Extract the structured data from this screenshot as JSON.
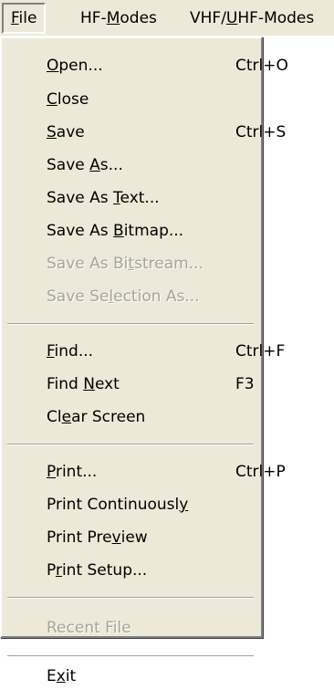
{
  "menubar": {
    "items": [
      {
        "pre": "",
        "ul": "F",
        "post": "ile"
      },
      {
        "pre": "HF-",
        "ul": "M",
        "post": "odes"
      },
      {
        "pre": "VHF/",
        "ul": "U",
        "post": "HF-Modes"
      }
    ]
  },
  "file_menu": {
    "items": [
      {
        "pre": "",
        "ul": "O",
        "post": "pen...",
        "shortcut": "Ctrl+O",
        "enabled": true
      },
      {
        "pre": "",
        "ul": "C",
        "post": "lose",
        "shortcut": "",
        "enabled": true
      },
      {
        "pre": "",
        "ul": "S",
        "post": "ave",
        "shortcut": "Ctrl+S",
        "enabled": true
      },
      {
        "pre": "Save ",
        "ul": "A",
        "post": "s...",
        "shortcut": "",
        "enabled": true
      },
      {
        "pre": "Save As ",
        "ul": "T",
        "post": "ext...",
        "shortcut": "",
        "enabled": true
      },
      {
        "pre": "Save As ",
        "ul": "B",
        "post": "itmap...",
        "shortcut": "",
        "enabled": true
      },
      {
        "pre": "Save As Bi",
        "ul": "t",
        "post": "stream...",
        "shortcut": "",
        "enabled": false
      },
      {
        "pre": "Save Se",
        "ul": "l",
        "post": "ection As...",
        "shortcut": "",
        "enabled": false
      },
      {
        "pre": "",
        "ul": "F",
        "post": "ind...",
        "shortcut": "Ctrl+F",
        "enabled": true
      },
      {
        "pre": "Find ",
        "ul": "N",
        "post": "ext",
        "shortcut": "F3",
        "enabled": true
      },
      {
        "pre": "Cl",
        "ul": "e",
        "post": "ar Screen",
        "shortcut": "",
        "enabled": true
      },
      {
        "pre": "",
        "ul": "P",
        "post": "rint...",
        "shortcut": "Ctrl+P",
        "enabled": true
      },
      {
        "pre": "Print Continuousl",
        "ul": "y",
        "post": "",
        "shortcut": "",
        "enabled": true
      },
      {
        "pre": "Print Pre",
        "ul": "v",
        "post": "iew",
        "shortcut": "",
        "enabled": true
      },
      {
        "pre": "P",
        "ul": "r",
        "post": "int Setup...",
        "shortcut": "",
        "enabled": true
      },
      {
        "pre": "Recent File",
        "ul": "",
        "post": "",
        "shortcut": "",
        "enabled": false
      },
      {
        "pre": "E",
        "ul": "x",
        "post": "it",
        "shortcut": "",
        "enabled": true
      }
    ]
  }
}
